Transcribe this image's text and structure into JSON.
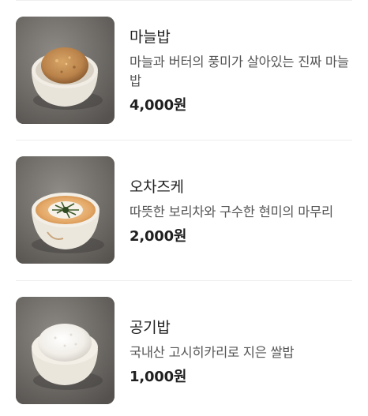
{
  "menu": {
    "items": [
      {
        "name": "마늘밥",
        "description": "마늘과 버터의 풍미가 살아있는 진짜 마늘밥",
        "price": "4,000원",
        "image": "garlic-rice-bowl-photo"
      },
      {
        "name": "오차즈케",
        "description": "따뜻한 보리차와 구수한 현미의 마무리",
        "price": "2,000원",
        "image": "ochazuke-bowl-photo"
      },
      {
        "name": "공기밥",
        "description": "국내산 고시히카리로 지은 쌀밥",
        "price": "1,000원",
        "image": "plain-rice-bowl-photo"
      }
    ]
  }
}
